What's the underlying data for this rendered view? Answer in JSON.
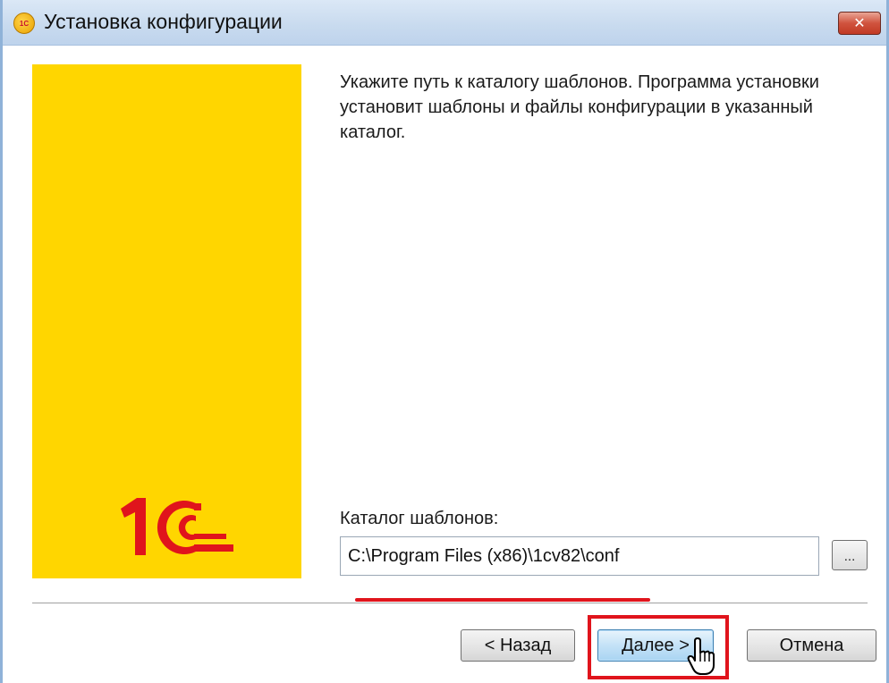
{
  "window": {
    "title": "Установка конфигурации",
    "app_icon_text": "1С",
    "close_glyph": "✕"
  },
  "banner": {
    "background_color": "#ffd600",
    "logo_color": "#e0141c",
    "logo_text": "1С"
  },
  "content": {
    "message": "Укажите путь к каталогу шаблонов. Программа установки установит шаблоны и файлы конфигурации в указанный каталог.",
    "path_label": "Каталог шаблонов:",
    "path_value": "C:\\Program Files (x86)\\1cv82\\conf",
    "browse_label": "..."
  },
  "buttons": {
    "back": "< Назад",
    "next": "Далее >",
    "cancel": "Отмена"
  },
  "annotations": {
    "highlight_color": "#e0141c"
  }
}
